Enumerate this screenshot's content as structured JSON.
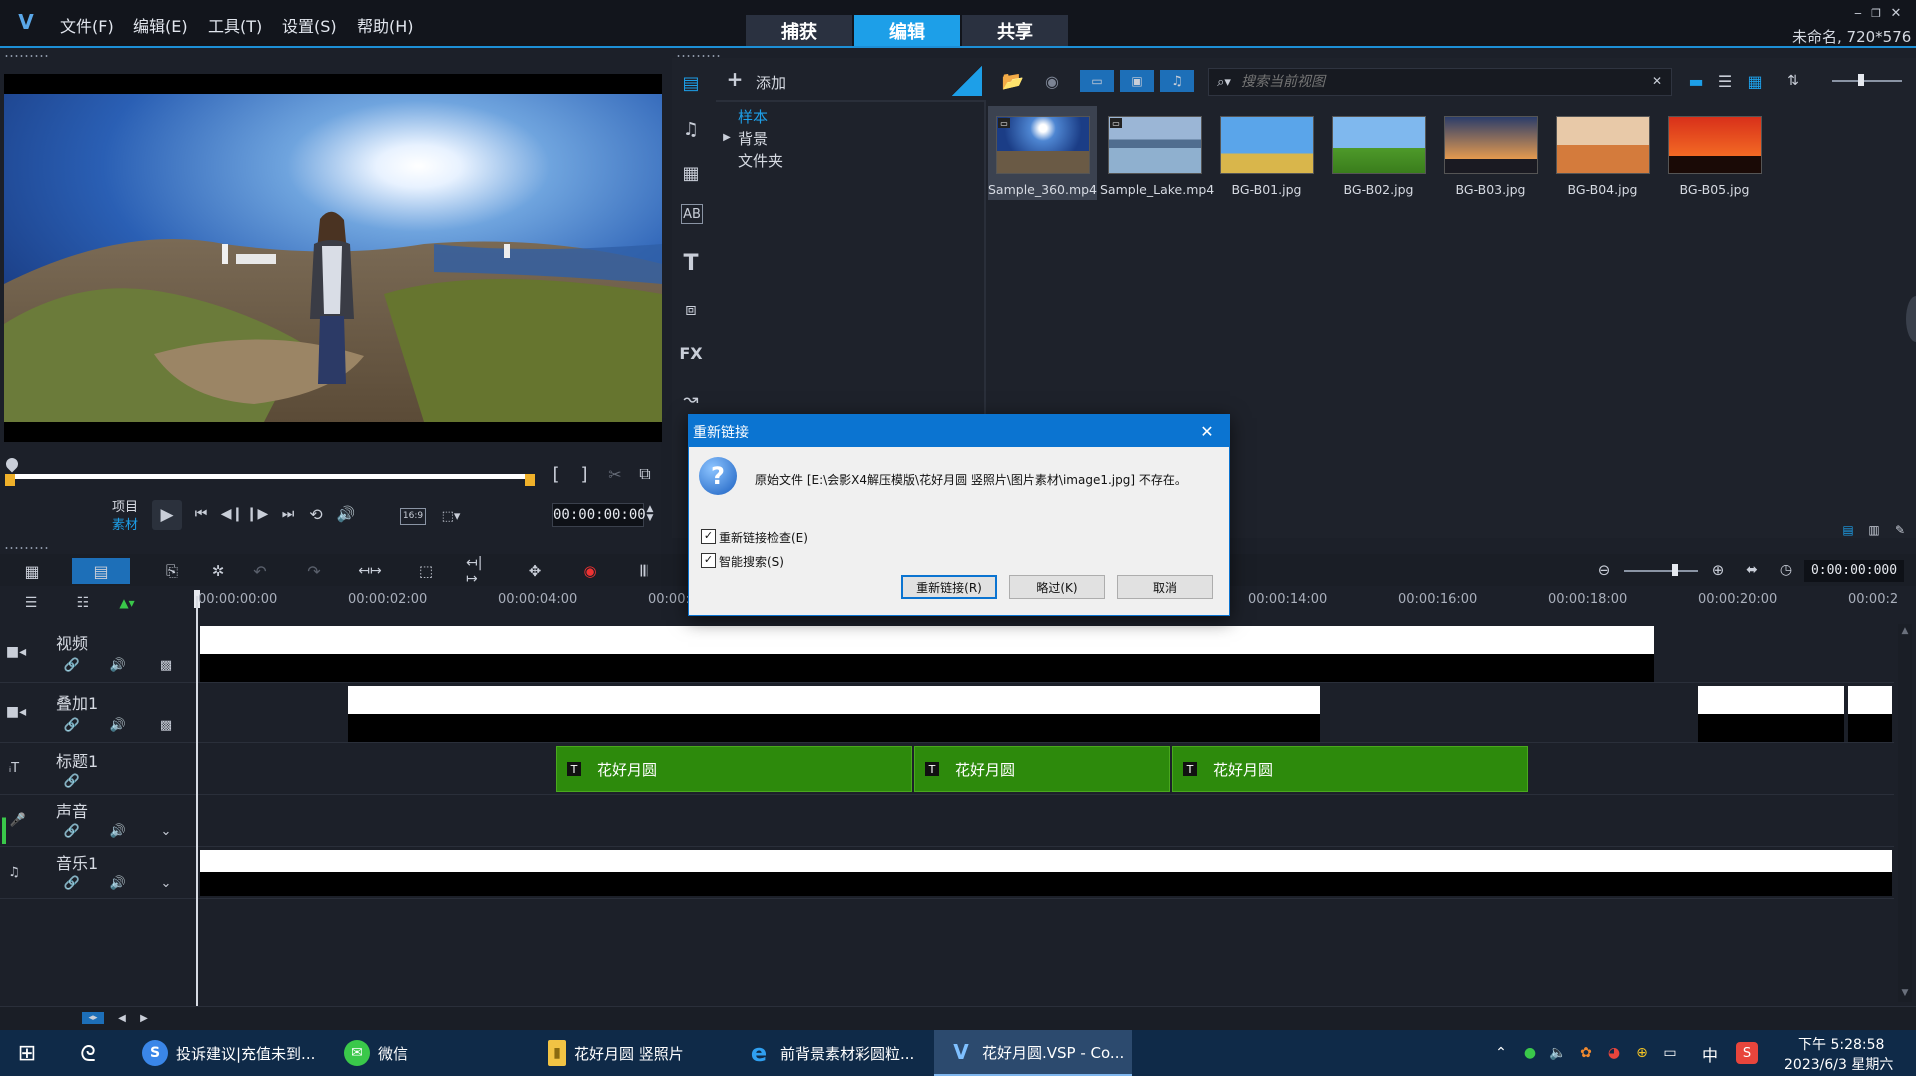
{
  "app": {
    "logo": "V",
    "project_info": "未命名, 720*576"
  },
  "menu": [
    "文件(F)",
    "编辑(E)",
    "工具(T)",
    "设置(S)",
    "帮助(H)"
  ],
  "mode_tabs": [
    "捕获",
    "编辑",
    "共享"
  ],
  "player": {
    "mode_project": "项目",
    "mode_clip": "素材",
    "timecode": "00:00:00:00",
    "aspect": "16:9"
  },
  "library": {
    "add_label": "添加",
    "tree": [
      "样本",
      "背景",
      "文件夹"
    ],
    "search_placeholder": "搜索当前视图",
    "thumbnails": [
      "Sample_360.mp4",
      "Sample_Lake.mp4",
      "BG-B01.jpg",
      "BG-B02.jpg",
      "BG-B03.jpg",
      "BG-B04.jpg",
      "BG-B05.jpg"
    ]
  },
  "sidebar_icons": [
    "media-icon",
    "audio-icon",
    "instant-project-icon",
    "text-ab-icon",
    "title-icon",
    "transition-icon",
    "fx-icon",
    "path-icon"
  ],
  "timeline": {
    "timecode": "0:00:00:000",
    "ruler": [
      "00:00:00:00",
      "00:00:02:00",
      "00:00:04:00",
      "00:00:",
      "00:00:14:00",
      "00:00:16:00",
      "00:00:18:00",
      "00:00:20:00",
      "00:00:2"
    ],
    "tracks": [
      "视频",
      "叠加1",
      "标题1",
      "声音",
      "音乐1"
    ],
    "title_clips": [
      "花好月圆",
      "花好月圆",
      "花好月圆"
    ]
  },
  "dialog": {
    "title": "重新链接",
    "message": "原始文件 [E:\\会影X4解压模版\\花好月圆 竖照片\\图片素材\\image1.jpg] 不存在。",
    "checks": [
      "重新链接检查(E)",
      "智能搜索(S)"
    ],
    "buttons": [
      "重新链接(R)",
      "略过(K)",
      "取消"
    ]
  },
  "taskbar": {
    "items": [
      "投诉建议|充值未到...",
      "微信",
      "花好月圆 竖照片",
      "前背景素材彩圆粒...",
      "花好月圆.VSP - Co..."
    ],
    "tray_lang": "中",
    "time": "下午 5:28:58",
    "date": "2023/6/3 星期六"
  }
}
